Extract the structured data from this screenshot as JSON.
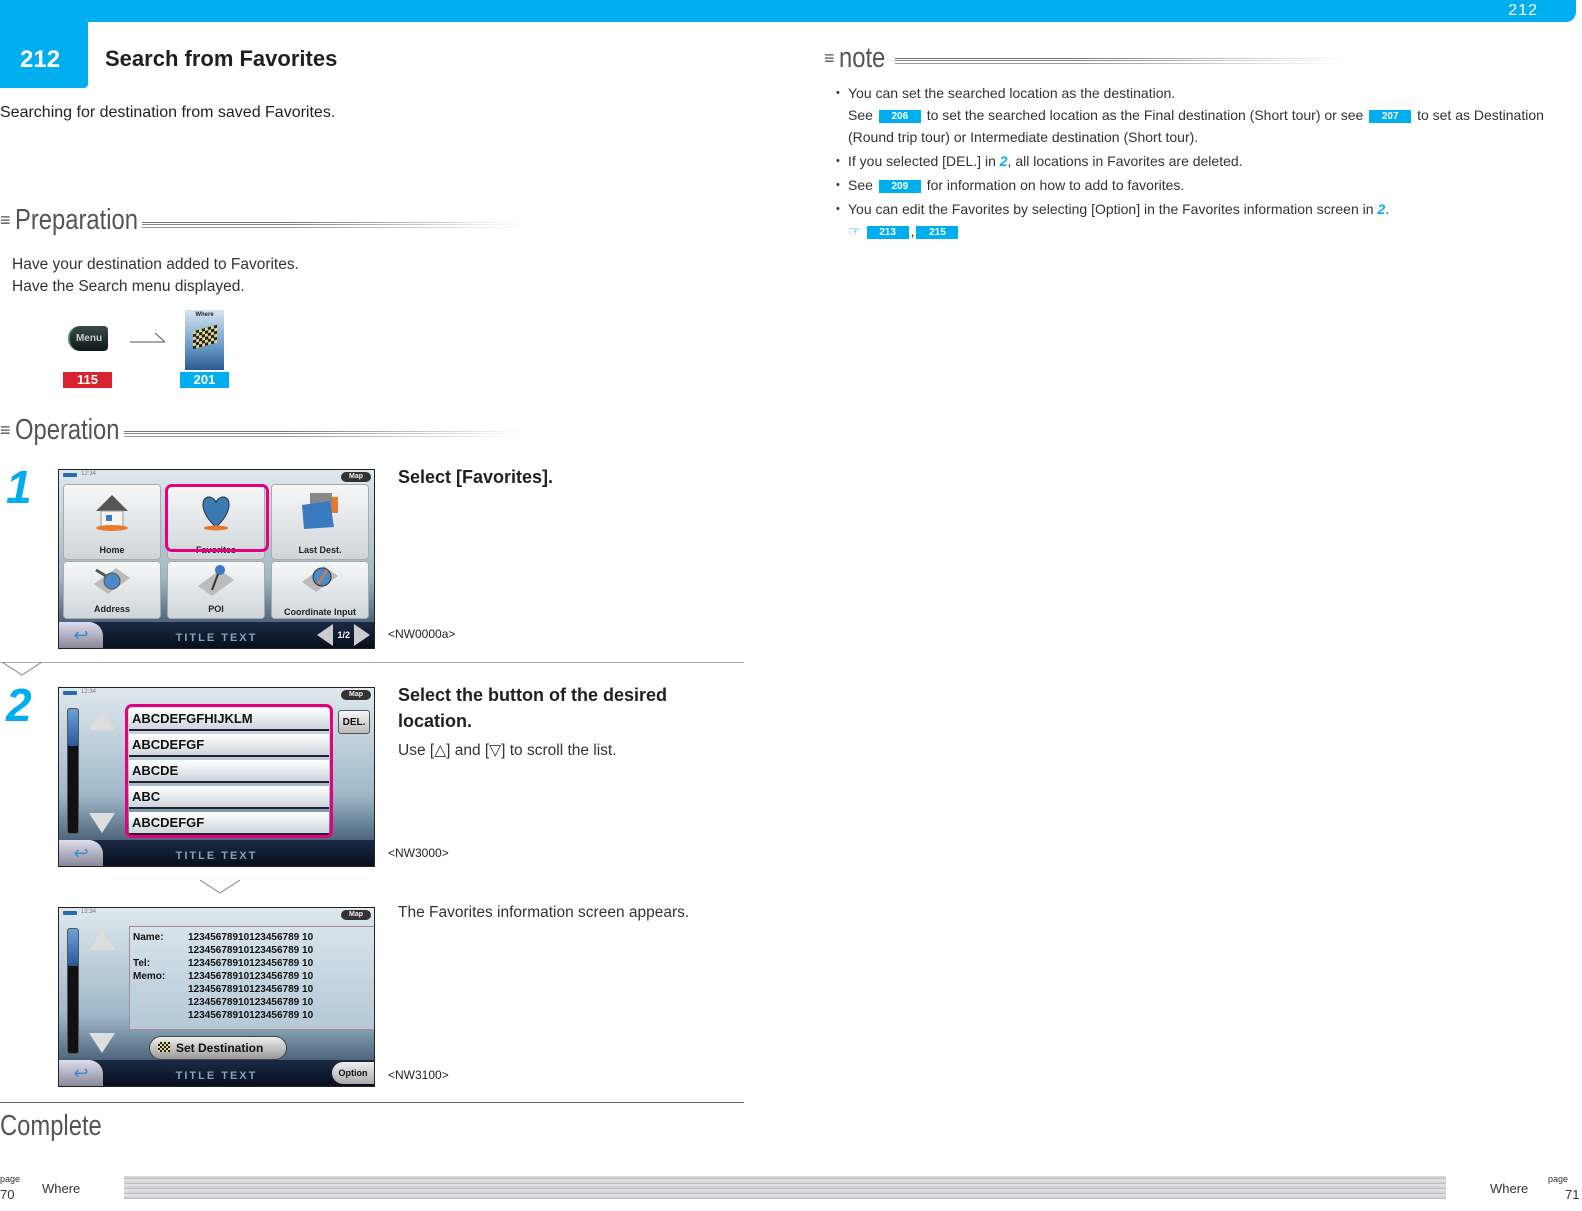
{
  "header": {
    "page_label": "212",
    "chapter_number": "212",
    "title": "Search from Favorites",
    "subtitle": "Searching for destination from saved Favorites."
  },
  "preparation": {
    "heading": "Preparation",
    "lines": [
      "Have your destination added to Favorites.",
      "Have the Search menu displayed."
    ],
    "menu_button": "Menu",
    "where_icon_label": "Where",
    "refs": [
      {
        "label": "115",
        "color": "#d7232f"
      },
      {
        "label": "201",
        "color": "#00aeef"
      }
    ]
  },
  "operation": {
    "heading": "Operation",
    "steps": [
      {
        "number": "1",
        "title": "Select [Favorites].",
        "screen_code": "<NW0000a>",
        "screen": {
          "clock": "12:34",
          "map_button": "Map",
          "tiles": [
            "Home",
            "Favorites",
            "Last Dest.",
            "Address",
            "POI",
            "Coordinate Input"
          ],
          "highlighted": "Favorites",
          "title_text": "TITLE TEXT",
          "pager": "1/2"
        }
      },
      {
        "number": "2",
        "title": "Select the button of the desired location.",
        "desc_prefix": "Use [",
        "desc_up": "△",
        "desc_mid": "] and [",
        "desc_down": "▽",
        "desc_suffix": "] to scroll the list.",
        "screen_code": "<NW3000>",
        "screen": {
          "clock": "12:34",
          "map_button": "Map",
          "list": [
            "ABCDEFGFHIJKLM",
            "ABCDEFGF",
            "ABCDE",
            "ABC",
            "ABCDEFGF"
          ],
          "del_button": "DEL.",
          "title_text": "TITLE TEXT",
          "scroll_position": 0.3
        }
      },
      {
        "result": "The Favorites information screen appears.",
        "screen_code": "<NW3100>",
        "screen": {
          "clock": "12:34",
          "map_button": "Map",
          "rows": [
            {
              "key": "Name:",
              "value": "12345678910123456789 10"
            },
            {
              "key": "",
              "value": "12345678910123456789 10"
            },
            {
              "key": "Tel:",
              "value": "12345678910123456789 10"
            },
            {
              "key": "Memo:",
              "value": "12345678910123456789 10"
            },
            {
              "key": "",
              "value": "12345678910123456789 10"
            },
            {
              "key": "",
              "value": "12345678910123456789 10"
            },
            {
              "key": "",
              "value": "12345678910123456789 10"
            }
          ],
          "set_destination": "Set Destination",
          "option_button": "Option",
          "title_text": "TITLE TEXT",
          "scroll_position": 0.3
        }
      }
    ],
    "complete": "Complete"
  },
  "note": {
    "heading": "note",
    "items": [
      {
        "parts": [
          "You can set the searched location as the destination."
        ]
      },
      {
        "see": "See",
        "ref1": "206",
        "mid": "to set the searched location as the Final destination (Short tour) or see",
        "ref2": "207",
        "end": "to set as Destination (Round trip tour) or Intermediate destination (Short tour)."
      },
      {
        "pre": "If you selected [DEL.] in",
        "step": "2",
        "post": ", all locations in Favorites are deleted."
      },
      {
        "pre": "See",
        "ref": "209",
        "post": "for information on how to add to favorites."
      },
      {
        "pre": "You can edit the Favorites by selecting [Option] in the Favorites information screen in",
        "step": "2",
        "post": ".",
        "refs": [
          "213",
          "215"
        ]
      }
    ]
  },
  "footer": {
    "left_page_label": "page",
    "left_page": "70",
    "left_section": "Where",
    "right_page_label": "page",
    "right_page": "71",
    "right_section": "Where"
  },
  "colors": {
    "accent": "#00aeef",
    "red_ref": "#d7232f",
    "highlight": "#e6007e"
  }
}
